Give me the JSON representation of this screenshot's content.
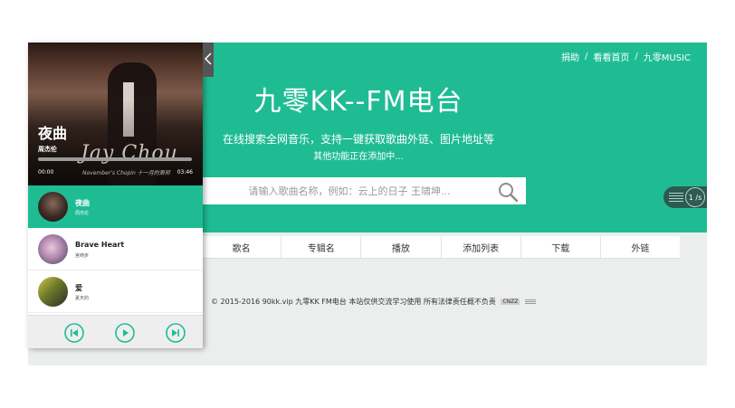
{
  "topnav": {
    "items": [
      "捐助",
      "看看首页",
      "九零MUSIC"
    ],
    "separator": "/"
  },
  "hero": {
    "title": "九零KK--FM电台",
    "subtitle": "在线搜索全网音乐，支持一键获取歌曲外链、图片地址等",
    "subtitle2": "其他功能正在添加中..."
  },
  "search": {
    "placeholder": "请输入歌曲名称，例如：云上的日子 王啸坤...",
    "icon": "search-icon"
  },
  "table": {
    "headers": [
      "歌名",
      "专辑名",
      "播放",
      "添加列表",
      "下载",
      "外链"
    ]
  },
  "footer": {
    "text": "© 2015-2016 90kk.vip 九零KK FM电台 本站仅供交流学习使用 所有法律责任概不负责",
    "badge": "CNZZ"
  },
  "mini_player": {
    "time": "1 /s"
  },
  "player": {
    "now_playing": {
      "title": "夜曲",
      "artist": "周杰伦",
      "current_time": "00:00",
      "duration": "03:46",
      "progress": 0.0
    },
    "cover": {
      "brand": "Jay Chou",
      "tagline": "November's Chopin  十一月的萧邦"
    },
    "songs": [
      {
        "name": "夜曲",
        "artist": "周杰伦",
        "active": true
      },
      {
        "name": "Brave Heart",
        "artist": "宫崎步",
        "active": false
      },
      {
        "name": "爱",
        "artist": "夏天的"
      }
    ],
    "controls": [
      "prev-icon",
      "play-icon",
      "next-icon"
    ]
  },
  "colors": {
    "accent": "#1fbc94",
    "page_bg": "#eceeee",
    "player_bg": "#ffffff"
  }
}
